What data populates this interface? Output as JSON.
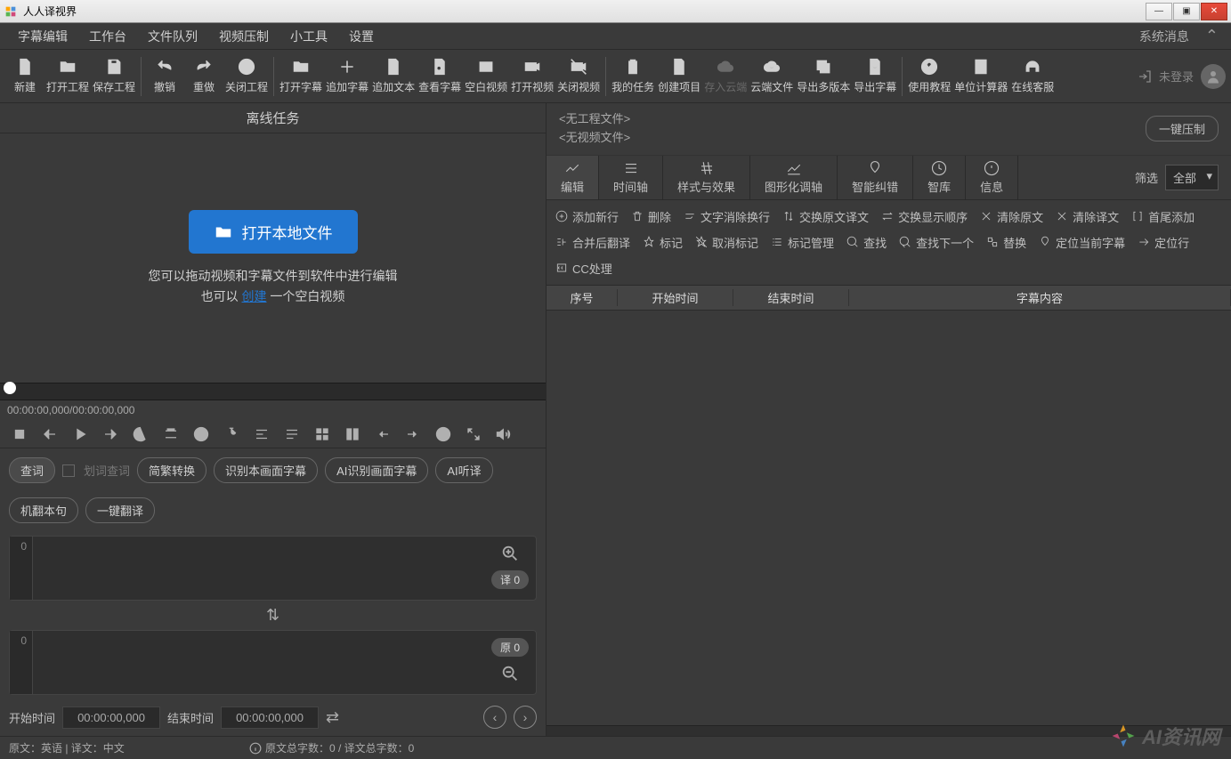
{
  "app": {
    "title": "人人译视界"
  },
  "menubar": {
    "items": [
      "字幕编辑",
      "工作台",
      "文件队列",
      "视频压制",
      "小工具",
      "设置"
    ],
    "sysmsg": "系统消息"
  },
  "toolbar": [
    {
      "label": "新建",
      "icon": "file-plus"
    },
    {
      "label": "打开工程",
      "icon": "folder"
    },
    {
      "label": "保存工程",
      "icon": "save"
    },
    {
      "sep": true
    },
    {
      "label": "撤销",
      "icon": "undo"
    },
    {
      "label": "重做",
      "icon": "redo"
    },
    {
      "label": "关闭工程",
      "icon": "close-circle"
    },
    {
      "sep": true
    },
    {
      "label": "打开字幕",
      "icon": "folder"
    },
    {
      "label": "追加字幕",
      "icon": "plus"
    },
    {
      "label": "追加文本",
      "icon": "doc"
    },
    {
      "label": "查看字幕",
      "icon": "search-doc"
    },
    {
      "label": "空白视频",
      "icon": "blank-video"
    },
    {
      "label": "打开视频",
      "icon": "video"
    },
    {
      "label": "关闭视频",
      "icon": "video-off"
    },
    {
      "sep": true
    },
    {
      "label": "我的任务",
      "icon": "clipboard"
    },
    {
      "label": "创建项目",
      "icon": "add-doc"
    },
    {
      "label": "存入云端",
      "icon": "cloud",
      "dim": true
    },
    {
      "label": "云端文件",
      "icon": "cloud-dl"
    },
    {
      "label": "导出多版本",
      "icon": "export-multi"
    },
    {
      "label": "导出字幕",
      "icon": "export-sub"
    },
    {
      "sep": true
    },
    {
      "label": "使用教程",
      "icon": "help"
    },
    {
      "label": "单位计算器",
      "icon": "calc"
    },
    {
      "label": "在线客服",
      "icon": "headset"
    }
  ],
  "login": {
    "text": "未登录"
  },
  "left": {
    "offline_title": "离线任务",
    "open_local": "打开本地文件",
    "hint1": "您可以拖动视频和字幕文件到软件中进行编辑",
    "hint2_pre": "也可以 ",
    "hint2_link": "创建",
    "hint2_post": " 一个空白视频",
    "timecode": "00:00:00,000/00:00:00,000",
    "pills1": [
      "查词",
      "划词查词",
      "简繁转换",
      "识别本画面字幕",
      "AI识别画面字幕",
      "AI听译"
    ],
    "pills2": [
      "机翻本句",
      "一键翻译"
    ],
    "badge_translate": "译 0",
    "badge_original": "原 0",
    "gutter1": "0",
    "gutter2": "0",
    "start_label": "开始时间",
    "end_label": "结束时间",
    "start_value": "00:00:00,000",
    "end_value": "00:00:00,000"
  },
  "right": {
    "no_project": "<无工程文件>",
    "no_video": "<无视频文件>",
    "compress": "一键压制",
    "tabs": [
      "编辑",
      "时间轴",
      "样式与效果",
      "图形化调轴",
      "智能纠错",
      "智库",
      "信息"
    ],
    "filter_label": "筛选",
    "filter_value": "全部",
    "actions": [
      "添加新行",
      "删除",
      "文字消除换行",
      "交换原文译文",
      "交换显示顺序",
      "清除原文",
      "清除译文",
      "首尾添加",
      "合并后翻译",
      "标记",
      "取消标记",
      "标记管理",
      "查找",
      "查找下一个",
      "替换",
      "定位当前字幕",
      "定位行",
      "CC处理"
    ],
    "action_icons": [
      "plus-circle",
      "trash",
      "nowrap",
      "swap-v",
      "swap-h",
      "clear",
      "clear",
      "bracket",
      "merge",
      "pin",
      "unpin",
      "list",
      "search",
      "next",
      "replace",
      "locate",
      "goto",
      "cc"
    ],
    "columns": [
      "序号",
      "开始时间",
      "结束时间",
      "字幕内容"
    ]
  },
  "statusbar": {
    "lang": "原文：英语 | 译文：中文",
    "count": "原文总字数：0 / 译文总字数：0"
  },
  "watermark": "AI资讯网"
}
